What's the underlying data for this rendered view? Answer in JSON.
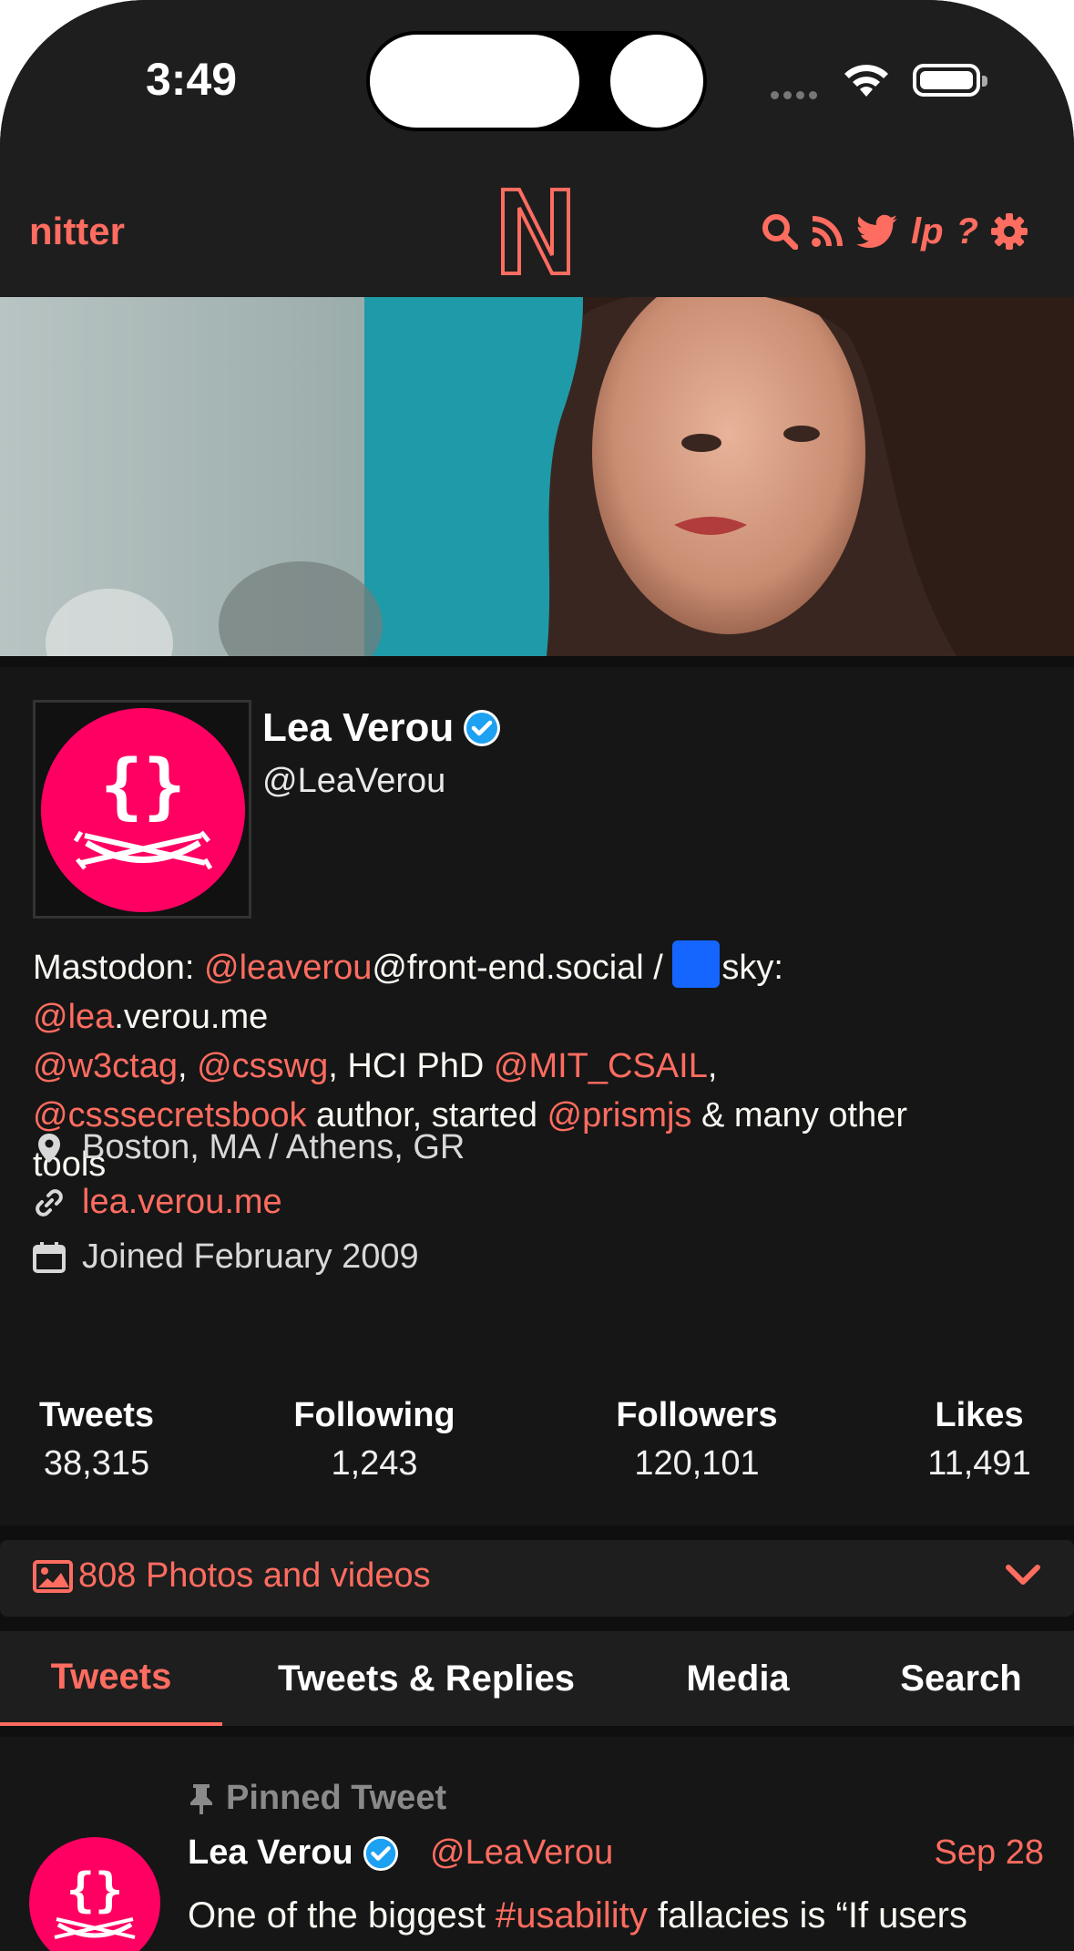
{
  "status_bar": {
    "time": "3:49"
  },
  "navbar": {
    "brand": "nitter",
    "icons": [
      "search-icon",
      "rss-icon",
      "twitter-icon",
      "lp-icon",
      "help-icon",
      "settings-icon"
    ],
    "lp_text": "lp",
    "help_text": "?",
    "accent": "#ff6c60"
  },
  "profile": {
    "fullname": "Lea Verou",
    "username": "@LeaVerou",
    "verified": true,
    "bio": {
      "line1": {
        "pre": "Mastodon: ",
        "link": "@leaverou",
        "post": "@front-end.social / ",
        "post2": "sky:"
      },
      "line2": {
        "link": "@lea",
        "post": ".verou.me"
      },
      "line3": {
        "link1": "@w3ctag",
        "sep1": ", ",
        "link2": "@csswg",
        "mid": ", HCI PhD ",
        "link3": "@MIT_CSAIL",
        "end": ","
      },
      "line4": {
        "link1": "@csssecretsbook",
        "mid": " author, started ",
        "link2": "@prismjs",
        "end": " & many other"
      },
      "line5": "tools"
    },
    "location": "Boston, MA / Athens, GR",
    "website": "lea.verou.me",
    "joined": "Joined February 2009",
    "stats": [
      {
        "label": "Tweets",
        "value": "38,315"
      },
      {
        "label": "Following",
        "value": "1,243"
      },
      {
        "label": "Followers",
        "value": "120,101"
      },
      {
        "label": "Likes",
        "value": "11,491"
      }
    ]
  },
  "photos": {
    "label": "808 Photos and videos"
  },
  "tabs": [
    {
      "label": "Tweets",
      "active": true
    },
    {
      "label": "Tweets & Replies",
      "active": false
    },
    {
      "label": "Media",
      "active": false
    },
    {
      "label": "Search",
      "active": false
    }
  ],
  "tweet": {
    "pinned_label": "Pinned Tweet",
    "fullname": "Lea Verou",
    "username": "@LeaVerou",
    "date": "Sep 28",
    "text_pre": "One of the biggest ",
    "text_link": "#usability",
    "text_post": " fallacies is “If users"
  }
}
